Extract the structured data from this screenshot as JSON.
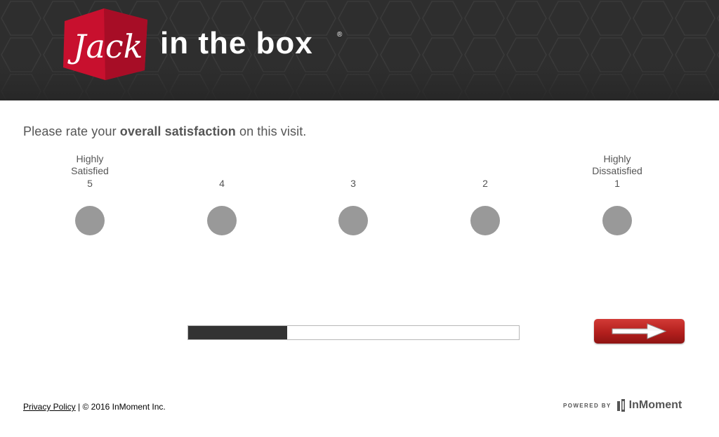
{
  "brand": {
    "logo_box_text": "Jack",
    "logo_text": "in the box",
    "registered_mark": "®"
  },
  "question": {
    "prefix": "Please rate your ",
    "emphasis": "overall satisfaction",
    "suffix": " on this visit."
  },
  "scale": [
    {
      "label_lines": [
        "Highly",
        "Satisfied"
      ],
      "value": "5"
    },
    {
      "label_lines": [],
      "value": "4"
    },
    {
      "label_lines": [],
      "value": "3"
    },
    {
      "label_lines": [],
      "value": "2"
    },
    {
      "label_lines": [
        "Highly",
        "Dissatisfied"
      ],
      "value": "1"
    }
  ],
  "progress": {
    "fraction": 0.3
  },
  "next_button": {
    "icon": "arrow-right-icon"
  },
  "footer": {
    "privacy_link": "Privacy Policy",
    "copyright": " | © 2016 InMoment Inc.",
    "powered_by": "POWERED BY",
    "powered_name": "InMoment"
  },
  "colors": {
    "header_bg": "#2e2e2e",
    "brand_red": "#c8102e",
    "radio_gray": "#999999",
    "progress_fill": "#333333"
  }
}
